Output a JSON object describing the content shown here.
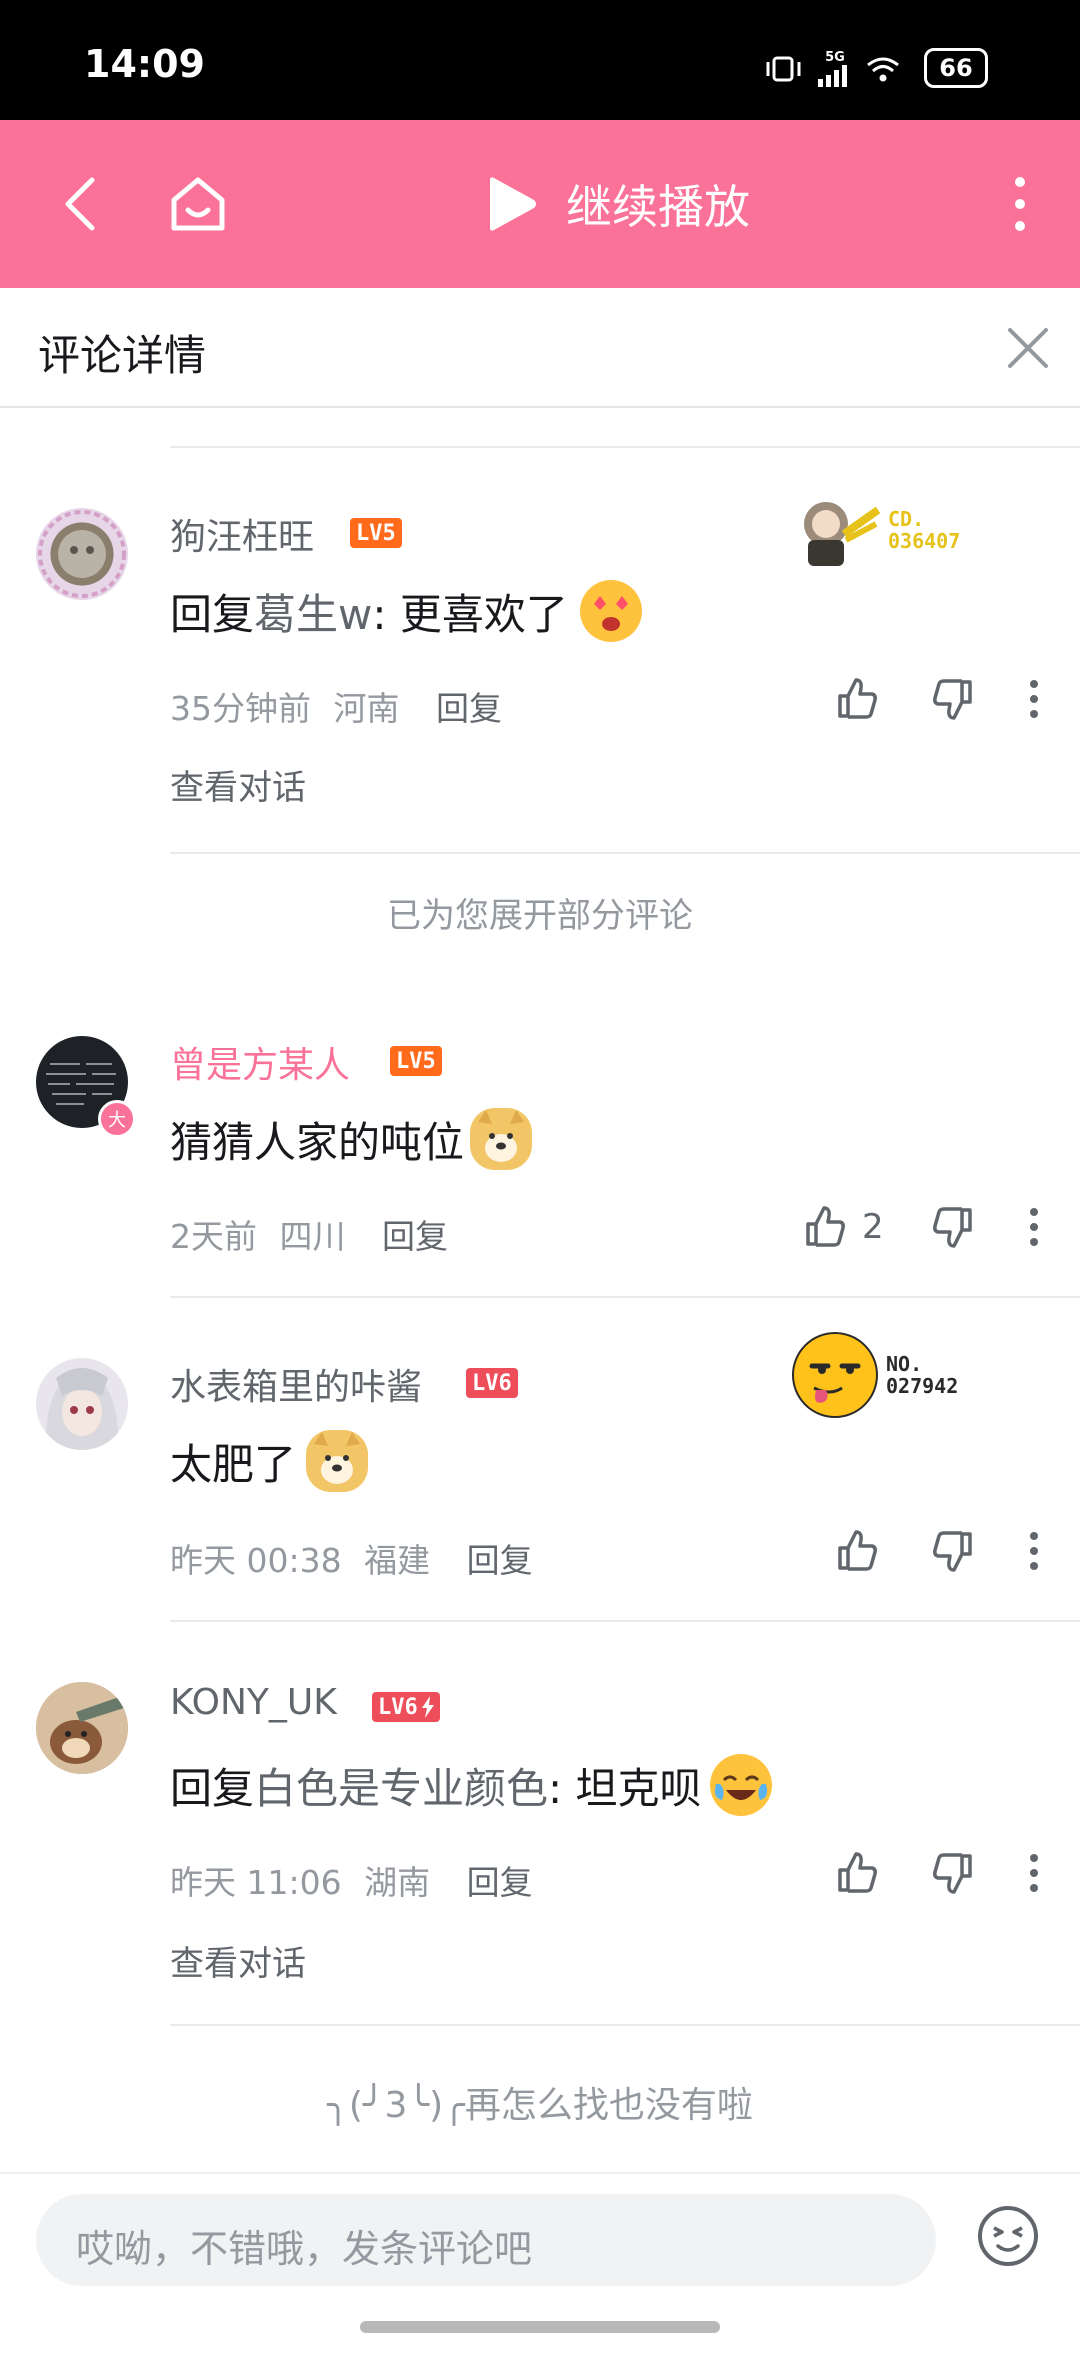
{
  "status_bar": {
    "time": "14:09",
    "battery": "66",
    "network": "5G"
  },
  "app_bar": {
    "continue_label": "继续播放"
  },
  "panel": {
    "title": "评论详情"
  },
  "comments": [
    {
      "username": "狗汪枉旺",
      "level": "LV5",
      "reply_prefix": "回复 ",
      "reply_target": "葛生w",
      "text": ": 更喜欢了",
      "time": "35分钟前",
      "location": "河南",
      "reply_label": "回复",
      "likes": "",
      "view_conversation": "查看对话",
      "fan_badge": {
        "line1": "CD.",
        "line2": "036407"
      }
    },
    {
      "username": "曾是方某人",
      "level": "LV5",
      "text": "猜猜人家的吨位",
      "time": "2天前",
      "location": "四川",
      "reply_label": "回复",
      "likes": "2",
      "avatar_badge": "大"
    },
    {
      "username": "水表箱里的咔酱",
      "level": "LV6",
      "text": "太肥了",
      "time": "昨天 00:38",
      "location": "福建",
      "reply_label": "回复",
      "likes": "",
      "fan_badge": {
        "line1": "NO.",
        "line2": "027942"
      }
    },
    {
      "username": "KONY_UK",
      "level": "LV6",
      "reply_prefix": "回复 ",
      "reply_target": "白色是专业颜色",
      "text": ": 坦克呗",
      "time": "昨天 11:06",
      "location": "湖南",
      "reply_label": "回复",
      "likes": "",
      "view_conversation": "查看对话"
    }
  ],
  "expanded_note": "已为您展开部分评论",
  "end_note": "╮(╯3╰)╭再怎么找也没有啦",
  "input": {
    "placeholder": "哎呦，不错哦，发条评论吧"
  },
  "colors": {
    "brand_pink": "#fb7299",
    "level_orange": "#ff6b1a",
    "level_red": "#ee4e5a",
    "secondary_text": "#9499a0"
  }
}
